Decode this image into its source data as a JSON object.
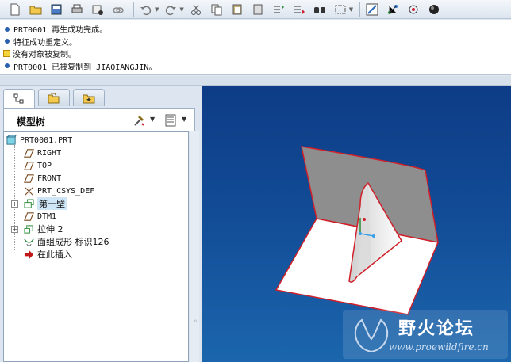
{
  "messages": [
    {
      "icon": "info-bullet",
      "text": "PRT0001 再生成功完成。"
    },
    {
      "icon": "info-bullet",
      "text": "特征成功重定义。"
    },
    {
      "icon": "warning-icon",
      "text": "没有对象被复制。"
    },
    {
      "icon": "info-bullet",
      "text": "PRT0001 已被复制到 JIAQIANGJIN。"
    }
  ],
  "model_tree": {
    "title": "模型树",
    "items": [
      {
        "label": "PRT0001.PRT",
        "icon": "part-icon"
      },
      {
        "label": "RIGHT",
        "icon": "datum-plane-icon"
      },
      {
        "label": "TOP",
        "icon": "datum-plane-icon"
      },
      {
        "label": "FRONT",
        "icon": "datum-plane-icon"
      },
      {
        "label": "PRT_CSYS_DEF",
        "icon": "csys-icon"
      },
      {
        "label": "第一壁",
        "icon": "wall-feature-icon"
      },
      {
        "label": "DTM1",
        "icon": "datum-plane-icon"
      },
      {
        "label": "拉伸 2",
        "icon": "extrude-feature-icon"
      },
      {
        "label": "面组成形 标识126",
        "icon": "form-feature-icon"
      },
      {
        "label": "在此插入",
        "icon": "insert-arrow-icon"
      }
    ]
  },
  "watermark": {
    "title": "野火论坛",
    "url": "www.proewildfire.cn"
  },
  "colors": {
    "viewport_top": "#0e3c86",
    "viewport_bottom": "#1b66ad",
    "model_edge": "#d0202a",
    "selected_item_bg": "#cfe6f7"
  }
}
